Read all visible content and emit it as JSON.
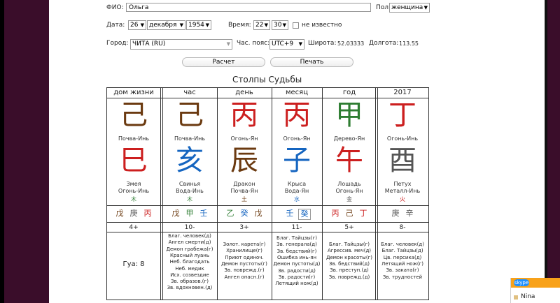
{
  "form": {
    "fio_label": "ФИО:",
    "fio_value": "Ольга",
    "gender_label": "Пол:",
    "gender_value": "женщина",
    "date_label": "Дата:",
    "day": "26",
    "month": "декабря",
    "year": "1954",
    "time_label": "Время:",
    "hour": "22",
    "minute": "30",
    "unknown_label": "не известно",
    "city_label": "Город:",
    "city_value": "ЧИТА (RU)",
    "tz_label": "Час. пояс:",
    "tz_value": "UTC+9",
    "lat_label": "Широта:",
    "lat_value": "52.03333",
    "lon_label": "Долгота:",
    "lon_value": "113.55",
    "calc_button": "Расчет",
    "print_button": "Печать"
  },
  "pillars_title": "Столпы Судьбы",
  "columns": [
    {
      "header": "дом жизни",
      "stem": "己",
      "stem_color": "#6b3a10",
      "stem_name": "Почва-Инь",
      "branch": "巳",
      "branch_color": "#cc1f1f",
      "branch_name": "Змея",
      "branch_element": "Огонь-Инь",
      "element_char": "木",
      "element_color": "#2e7d32",
      "hidden": [
        {
          "c": "戊",
          "color": "#6b3a10"
        },
        {
          "c": "庚",
          "color": "#555555"
        },
        {
          "c": "丙",
          "color": "#cc1f1f"
        }
      ],
      "number": "4+",
      "list": []
    },
    {
      "header": "час",
      "stem": "己",
      "stem_color": "#6b3a10",
      "stem_name": "Почва-Инь",
      "branch": "亥",
      "branch_color": "#1565c0",
      "branch_name": "Свинья",
      "branch_element": "Вода-Инь",
      "element_char": "木",
      "element_color": "#2e7d32",
      "hidden": [
        {
          "c": "戊",
          "color": "#6b3a10"
        },
        {
          "c": "甲",
          "color": "#2e7d32"
        },
        {
          "c": "壬",
          "color": "#1565c0"
        }
      ],
      "number": "10-",
      "list": [
        "Благ. человек(д)",
        "Ангел смерти(д)",
        "Демон грабежа(г)",
        "Красный луань",
        "Неб. благодать",
        "Неб. медик",
        "Исх. созвездие",
        "Зв. образов.(г)",
        "Зв. вдохновен.(д)"
      ]
    },
    {
      "header": "день",
      "stem": "丙",
      "stem_color": "#cc1f1f",
      "stem_name": "Огонь-Ян",
      "branch": "辰",
      "branch_color": "#6b3a10",
      "branch_name": "Дракон",
      "branch_element": "Почва-Ян",
      "element_char": "土",
      "element_color": "#6b3a10",
      "hidden": [
        {
          "c": "乙",
          "color": "#2e7d32"
        },
        {
          "c": "癸",
          "color": "#1565c0"
        },
        {
          "c": "戊",
          "color": "#6b3a10"
        }
      ],
      "number": "3+",
      "list": [
        "Золот. карета(г)",
        "Хранилище(г)",
        "Приют одиноч.",
        "Демон пустоты(г)",
        "Зв. поврежд.(г)",
        "Ангел опасн.(г)"
      ]
    },
    {
      "header": "месяц",
      "stem": "丙",
      "stem_color": "#cc1f1f",
      "stem_name": "Огонь-Ян",
      "branch": "子",
      "branch_color": "#1565c0",
      "branch_name": "Крыса",
      "branch_element": "Вода-Ян",
      "element_char": "水",
      "element_color": "#1565c0",
      "hidden": [
        {
          "c": "壬",
          "color": "#1565c0"
        },
        {
          "c": "癸",
          "color": "#1565c0"
        }
      ],
      "number": "11-",
      "list": [
        "Благ. Тайцзы(г)",
        "Зв. генерала(д)",
        "Зв. бедствий(г)",
        "Ошибка инь-ян",
        "Демон пустоты(д)",
        "Зв. радости(д)",
        "Зв. радости(г)",
        "Летящий нож(д)"
      ]
    },
    {
      "header": "год",
      "stem": "甲",
      "stem_color": "#2e7d32",
      "stem_name": "Дерево-Ян",
      "branch": "午",
      "branch_color": "#cc1f1f",
      "branch_name": "Лошадь",
      "branch_element": "Огонь-Ян",
      "element_char": "金",
      "element_color": "#555555",
      "hidden": [
        {
          "c": "丙",
          "color": "#cc1f1f"
        },
        {
          "c": "己",
          "color": "#6b3a10"
        },
        {
          "c": "丁",
          "color": "#cc1f1f"
        }
      ],
      "number": "5+",
      "list": [
        "Благ. Тайцзы(г)",
        "Агрессив. меч(д)",
        "Демон красоты(г)",
        "Зв. бедствий(д)",
        "Зв. преступ.(д)",
        "Зв. поврежд.(д)"
      ]
    },
    {
      "header": "2017",
      "stem": "丁",
      "stem_color": "#cc1f1f",
      "stem_name": "Огонь-Инь",
      "branch": "酉",
      "branch_color": "#555555",
      "branch_name": "Петух",
      "branch_element": "Металл-Инь",
      "element_char": "火",
      "element_color": "#cc1f1f",
      "hidden": [
        {
          "c": "庚",
          "color": "#555555"
        },
        {
          "c": "辛",
          "color": "#555555"
        }
      ],
      "number": "8-",
      "list": [
        "Благ. человек(д)",
        "Благ. Тайцзы(д)",
        "Цв. персика(д)",
        "Летящий нож(г)",
        "Зв. заката(г)",
        "Зв. трудностей"
      ]
    }
  ],
  "gua_label": "Гуа: 8",
  "skype": {
    "logo": "skype",
    "contact": "Nina"
  },
  "colors": {
    "accent_bar": "#f8a21a",
    "background": "#3a0d2a"
  }
}
